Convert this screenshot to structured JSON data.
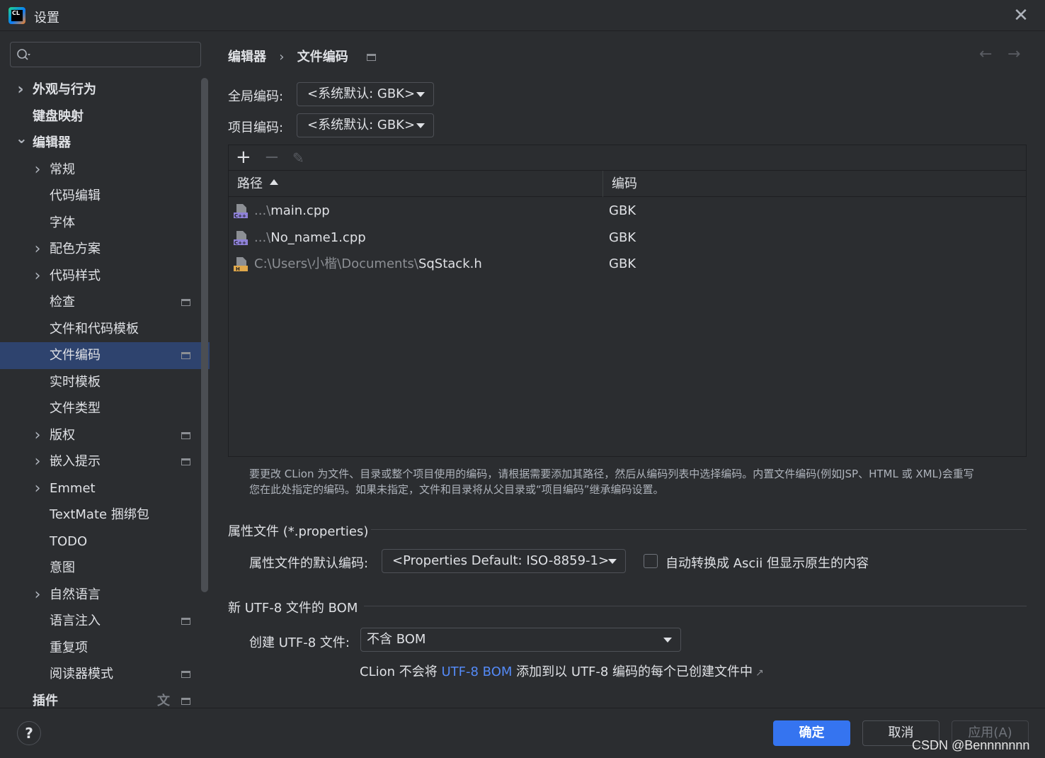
{
  "window": {
    "title": "设置",
    "close_glyph": "✕",
    "logo_text": "CL"
  },
  "search": {
    "placeholder": "",
    "value": ""
  },
  "sidebar": {
    "items": [
      {
        "label": "外观与行为",
        "expandable": true,
        "expanded": false,
        "bold": true,
        "level": 0
      },
      {
        "label": "键盘映射",
        "expandable": false,
        "bold": true,
        "level": 0
      },
      {
        "label": "编辑器",
        "expandable": true,
        "expanded": true,
        "bold": true,
        "level": 0
      },
      {
        "label": "常规",
        "expandable": true,
        "expanded": false,
        "level": 1
      },
      {
        "label": "代码编辑",
        "expandable": false,
        "level": 1
      },
      {
        "label": "字体",
        "expandable": false,
        "level": 1
      },
      {
        "label": "配色方案",
        "expandable": true,
        "expanded": false,
        "level": 1
      },
      {
        "label": "代码样式",
        "expandable": true,
        "expanded": false,
        "level": 1
      },
      {
        "label": "检查",
        "expandable": false,
        "level": 1,
        "badge": true
      },
      {
        "label": "文件和代码模板",
        "expandable": false,
        "level": 1
      },
      {
        "label": "文件编码",
        "expandable": false,
        "level": 1,
        "badge": true,
        "selected": true
      },
      {
        "label": "实时模板",
        "expandable": false,
        "level": 1
      },
      {
        "label": "文件类型",
        "expandable": false,
        "level": 1
      },
      {
        "label": "版权",
        "expandable": true,
        "expanded": false,
        "level": 1,
        "badge": true
      },
      {
        "label": "嵌入提示",
        "expandable": true,
        "expanded": false,
        "level": 1,
        "badge": true
      },
      {
        "label": "Emmet",
        "expandable": true,
        "expanded": false,
        "level": 1
      },
      {
        "label": "TextMate 捆绑包",
        "expandable": false,
        "level": 1
      },
      {
        "label": "TODO",
        "expandable": false,
        "level": 1
      },
      {
        "label": "意图",
        "expandable": false,
        "level": 1
      },
      {
        "label": "自然语言",
        "expandable": true,
        "expanded": false,
        "level": 1
      },
      {
        "label": "语言注入",
        "expandable": false,
        "level": 1,
        "badge": true
      },
      {
        "label": "重复项",
        "expandable": false,
        "level": 1
      },
      {
        "label": "阅读器模式",
        "expandable": false,
        "level": 1,
        "badge": true
      },
      {
        "label": "插件",
        "expandable": false,
        "bold": true,
        "level": 0,
        "badge": true,
        "translate_icon": true
      }
    ]
  },
  "breadcrumb": {
    "parent": "编辑器",
    "separator": "›",
    "current": "文件编码"
  },
  "nav": {
    "back": "←",
    "forward": "→"
  },
  "global_encoding": {
    "label": "全局编码:",
    "value": "<系统默认: GBK>"
  },
  "project_encoding": {
    "label": "项目编码:",
    "value": "<系统默认: GBK>"
  },
  "table": {
    "toolbar": {
      "add": "+",
      "remove": "−",
      "edit": "✎"
    },
    "columns": [
      "路径",
      "编码"
    ],
    "rows": [
      {
        "path_prefix": "...\\",
        "path_name": "main.cpp",
        "encoding": "GBK",
        "file_type": "cpp"
      },
      {
        "path_prefix": "...\\",
        "path_name": "No_name1.cpp",
        "encoding": "GBK",
        "file_type": "cpp"
      },
      {
        "path_prefix": "C:\\Users\\小楷\\Documents\\",
        "path_name": "SqStack.h",
        "encoding": "GBK",
        "file_type": "h"
      }
    ]
  },
  "help_text": {
    "line1": "要更改 CLion 为文件、目录或整个项目使用的编码，请根据需要添加其路径，然后从编码列表中选择编码。内置文件编码(例如JSP、HTML 或 XML)会重写",
    "line2": "您在此处指定的编码。如果未指定，文件和目录将从父目录或“项目编码”继承编码设置。"
  },
  "properties_group": {
    "title": "属性文件 (*.properties)",
    "default_label": "属性文件的默认编码:",
    "default_value": "<Properties Default: ISO-8859-1>",
    "ascii_checkbox_label": "自动转换成 Ascii 但显示原生的内容",
    "ascii_checked": false
  },
  "bom_group": {
    "title": "新 UTF-8 文件的 BOM",
    "create_label": "创建 UTF-8 文件:",
    "create_value": "不含 BOM",
    "info_prefix": "CLion 不会将 ",
    "info_link": "UTF-8 BOM",
    "info_suffix": " 添加到以 UTF-8 编码的每个已创建文件中",
    "info_ext_glyph": "↗"
  },
  "footer": {
    "help": "?",
    "ok": "确定",
    "cancel": "取消",
    "apply": "应用(A)",
    "watermark": "CSDN @Bennnnnnn"
  },
  "colors": {
    "background": "#2b2d30",
    "selection": "#2e436e",
    "primary_button": "#3574f0",
    "link": "#548af7",
    "h_file_icon": "#e0a84b",
    "cpp_file_icon": "#8f82d9"
  }
}
